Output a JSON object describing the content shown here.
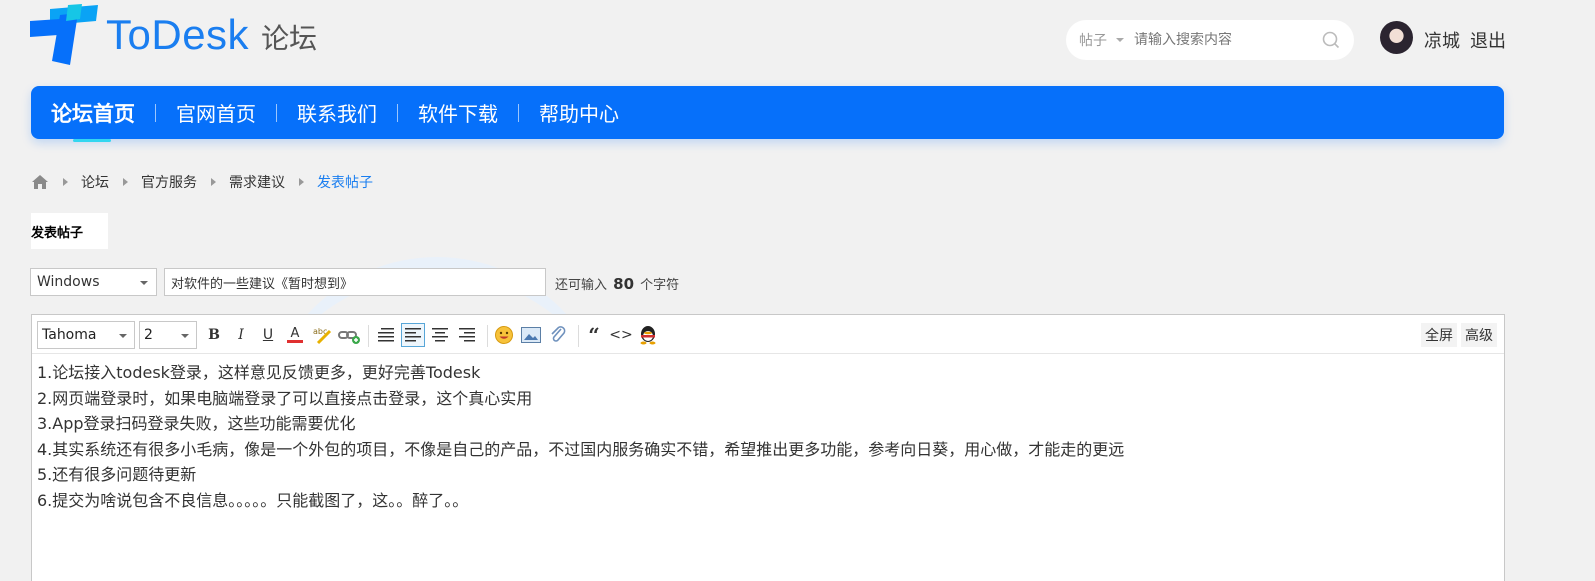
{
  "header": {
    "logo_text": "ToDesk",
    "logo_sub": "论坛",
    "search_type": "帖子",
    "search_placeholder": "请输入搜索内容",
    "username": "凉城",
    "logout": "退出"
  },
  "nav": {
    "items": [
      {
        "label": "论坛首页",
        "active": true
      },
      {
        "label": "官网首页"
      },
      {
        "label": "联系我们"
      },
      {
        "label": "软件下载"
      },
      {
        "label": "帮助中心"
      }
    ]
  },
  "breadcrumb": [
    "论坛",
    "官方服务",
    "需求建议",
    "发表帖子"
  ],
  "post_tab": "发表帖子",
  "form": {
    "type_value": "Windows",
    "subject_value": "对软件的一些建议《暂时想到》",
    "char_hint_prefix": "还可输入",
    "char_hint_count": "80",
    "char_hint_suffix": "个字符"
  },
  "toolbar": {
    "font": "Tahoma",
    "size": "2",
    "bold": "B",
    "italic": "I",
    "underline": "U",
    "font_color": "A",
    "quote": "“",
    "code": "<>",
    "fullscreen": "全屏",
    "advanced": "高级"
  },
  "content_lines": [
    "1.论坛接入todesk登录，这样意见反馈更多，更好完善Todesk",
    "2.网页端登录时，如果电脑端登录了可以直接点击登录，这个真心实用",
    "3.App登录扫码登录失败，这些功能需要优化",
    "4.其实系统还有很多小毛病，像是一个外包的项目，不像是自己的产品，不过国内服务确实不错，希望推出更多功能，参考向日葵，用心做，才能走的更远",
    "5.还有很多问题待更新",
    "6.提交为啥说包含不良信息。。。。。只能截图了，这。。醉了。。"
  ],
  "colors": {
    "brand": "#0670fa",
    "accent": "#1a7ef0",
    "nav_underline": "#33d6f0"
  }
}
